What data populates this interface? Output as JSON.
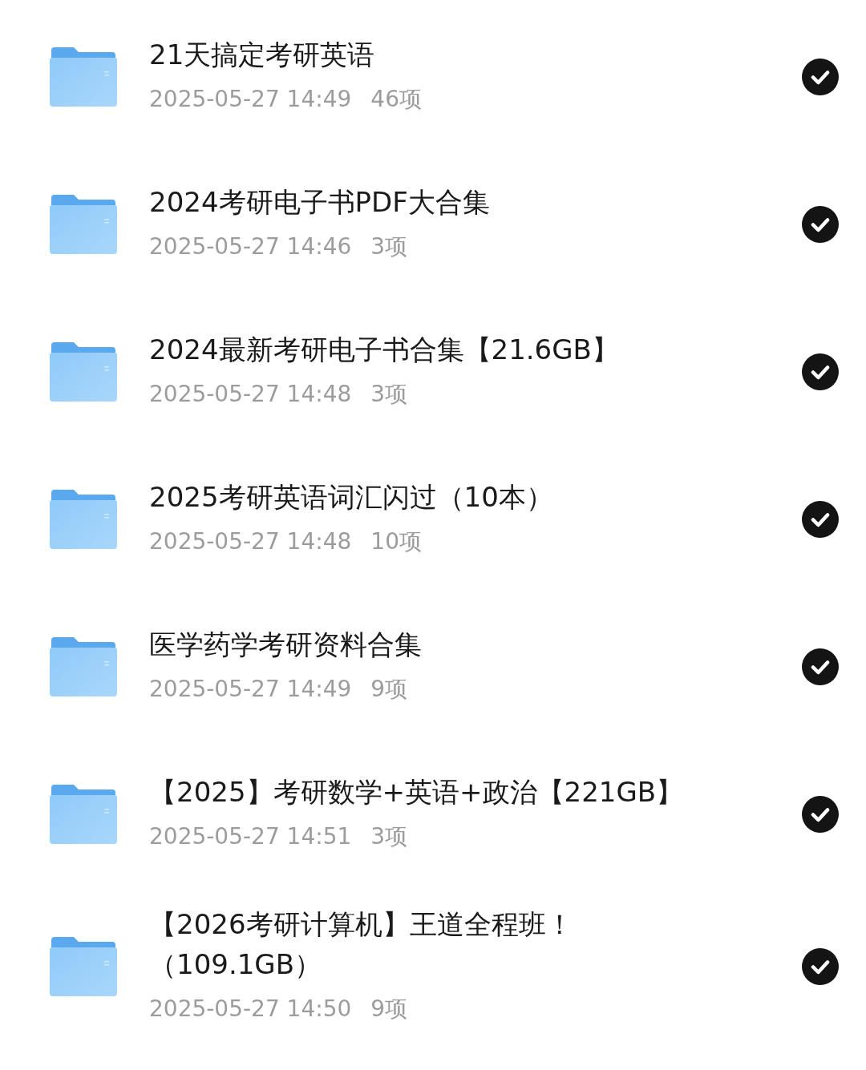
{
  "folders": [
    {
      "name": "21天搞定考研英语",
      "date": "2025-05-27 14:49",
      "count": "46项",
      "checked": true
    },
    {
      "name": "2024考研电子书PDF大合集",
      "date": "2025-05-27 14:46",
      "count": "3项",
      "checked": true
    },
    {
      "name": "2024最新考研电子书合集【21.6GB】",
      "date": "2025-05-27 14:48",
      "count": "3项",
      "checked": true
    },
    {
      "name": "2025考研英语词汇闪过（10本）",
      "date": "2025-05-27 14:48",
      "count": "10项",
      "checked": true
    },
    {
      "name": "医学药学考研资料合集",
      "date": "2025-05-27 14:49",
      "count": "9项",
      "checked": true
    },
    {
      "name": "【2025】考研数学+英语+政治【221GB】",
      "date": "2025-05-27 14:51",
      "count": "3项",
      "checked": true
    },
    {
      "name": "【2026考研计算机】王道全程班！（109.1GB）",
      "date": "2025-05-27 14:50",
      "count": "9项",
      "checked": true
    }
  ]
}
